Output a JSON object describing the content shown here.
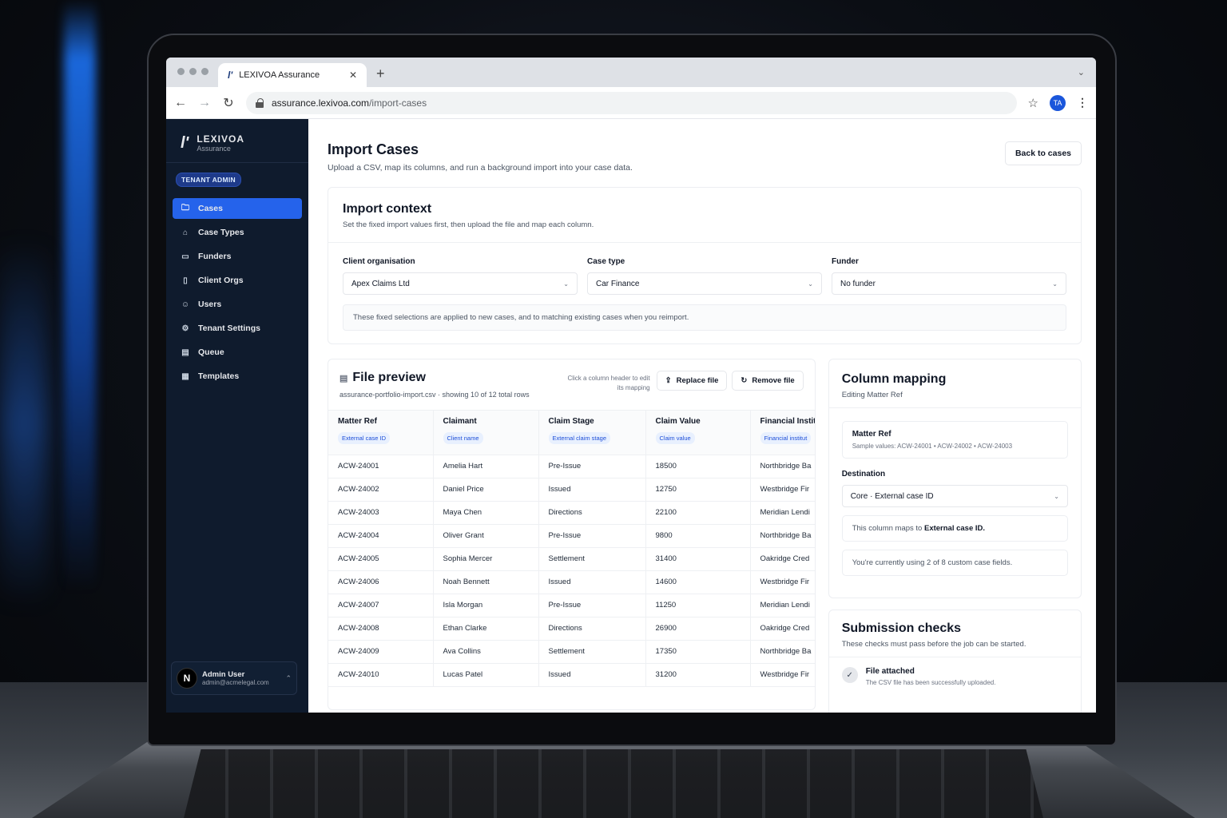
{
  "browser": {
    "tab_title": "LEXIVOA Assurance",
    "tab_logo": "l'",
    "url_host": "assurance.lexivoa.com",
    "url_path": "/import-cases",
    "profile_initials": "TA"
  },
  "sidebar": {
    "brand_mark": "l'",
    "brand_name": "LEXIVOA",
    "brand_sub": "Assurance",
    "role_badge": "TENANT ADMIN",
    "items": [
      {
        "label": "Cases",
        "icon": "folder-icon"
      },
      {
        "label": "Case Types",
        "icon": "tag-icon"
      },
      {
        "label": "Funders",
        "icon": "banknote-icon"
      },
      {
        "label": "Client Orgs",
        "icon": "building-icon"
      },
      {
        "label": "Users",
        "icon": "users-icon"
      },
      {
        "label": "Tenant Settings",
        "icon": "gear-icon"
      },
      {
        "label": "Queue",
        "icon": "clipboard-icon"
      },
      {
        "label": "Templates",
        "icon": "document-icon"
      }
    ],
    "user": {
      "initial": "N",
      "name": "Admin User",
      "email": "admin@acmelegal.com"
    }
  },
  "page": {
    "title": "Import Cases",
    "subtitle": "Upload a CSV, map its columns, and run a background import into your case data.",
    "back_button": "Back to cases"
  },
  "context": {
    "title": "Import context",
    "subtitle": "Set the fixed import values first, then upload the file and map each column.",
    "client_label": "Client organisation",
    "client_value": "Apex Claims Ltd",
    "case_type_label": "Case type",
    "case_type_value": "Car Finance",
    "funder_label": "Funder",
    "funder_value": "No funder",
    "note": "These fixed selections are applied to new cases, and to matching existing cases when you reimport."
  },
  "preview": {
    "title": "File preview",
    "meta": "assurance-portfolio-import.csv · showing 10 of 12 total rows",
    "hint": "Click a column header to edit its mapping",
    "replace_label": "Replace file",
    "remove_label": "Remove file",
    "columns": [
      {
        "name": "Matter Ref",
        "tag": "External case ID"
      },
      {
        "name": "Claimant",
        "tag": "Client name"
      },
      {
        "name": "Claim Stage",
        "tag": "External claim stage"
      },
      {
        "name": "Claim Value",
        "tag": "Claim value"
      },
      {
        "name": "Financial Instit",
        "tag": "Financial institut"
      }
    ],
    "rows": [
      [
        "ACW-24001",
        "Amelia Hart",
        "Pre-Issue",
        "18500",
        "Northbridge Ba"
      ],
      [
        "ACW-24002",
        "Daniel Price",
        "Issued",
        "12750",
        "Westbridge Fir"
      ],
      [
        "ACW-24003",
        "Maya Chen",
        "Directions",
        "22100",
        "Meridian Lendi"
      ],
      [
        "ACW-24004",
        "Oliver Grant",
        "Pre-Issue",
        "9800",
        "Northbridge Ba"
      ],
      [
        "ACW-24005",
        "Sophia Mercer",
        "Settlement",
        "31400",
        "Oakridge Cred"
      ],
      [
        "ACW-24006",
        "Noah Bennett",
        "Issued",
        "14600",
        "Westbridge Fir"
      ],
      [
        "ACW-24007",
        "Isla Morgan",
        "Pre-Issue",
        "11250",
        "Meridian Lendi"
      ],
      [
        "ACW-24008",
        "Ethan Clarke",
        "Directions",
        "26900",
        "Oakridge Cred"
      ],
      [
        "ACW-24009",
        "Ava Collins",
        "Settlement",
        "17350",
        "Northbridge Ba"
      ],
      [
        "ACW-24010",
        "Lucas Patel",
        "Issued",
        "31200",
        "Westbridge Fir"
      ]
    ]
  },
  "mapping": {
    "title": "Column mapping",
    "subtitle": "Editing Matter Ref",
    "column_name": "Matter Ref",
    "sample_values": "Sample values: ACW-24001 • ACW-24002 • ACW-24003",
    "destination_label": "Destination",
    "destination_value": "Core · External case ID",
    "maps_prefix": "This column maps to ",
    "maps_target": "External case ID.",
    "usage_note": "You're currently using 2 of 8 custom case fields."
  },
  "checks": {
    "title": "Submission checks",
    "subtitle": "These checks must pass before the job can be started.",
    "items": [
      {
        "title": "File attached",
        "desc": "The CSV file has been successfully uploaded.",
        "icon": "check-icon"
      }
    ]
  },
  "colors": {
    "accent": "#2563eb",
    "sidebar_bg": "#0f1b2d",
    "tag_bg": "#e8f0fe",
    "tag_text": "#1d4ed8"
  }
}
